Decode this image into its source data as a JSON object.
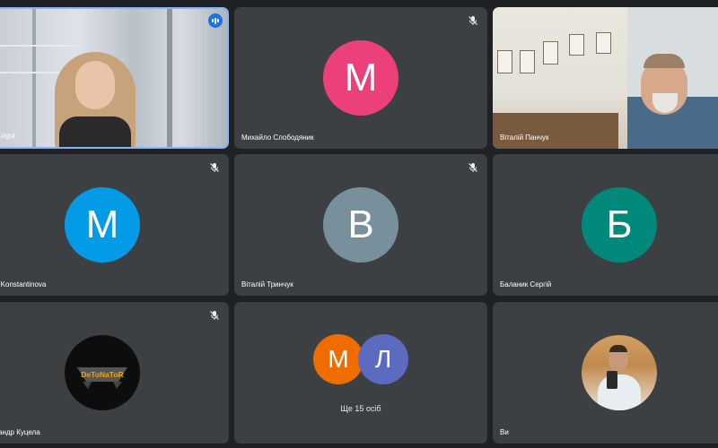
{
  "tiles": [
    {
      "name": "Kogut"
    },
    {
      "name": "Михайло Слободяник",
      "initial": "М",
      "color": "#ec407a"
    },
    {
      "name": "Віталій Панчук"
    },
    {
      "name": "a Konstantinova",
      "initial": "М",
      "color": "#039be5"
    },
    {
      "name": "Віталій Тринчук",
      "initial": "В",
      "color": "#78909c"
    },
    {
      "name": "Баланик Сергій",
      "initial": "Б",
      "color": "#00897b"
    },
    {
      "name": "сандр Куцела",
      "logo_text": "DeToNaToR"
    },
    {
      "name": "Ще 15 осіб",
      "initials": [
        {
          "letter": "М",
          "color": "#ef6c00"
        },
        {
          "letter": "Л",
          "color": "#5c6bc0"
        }
      ]
    },
    {
      "name": "Ви"
    }
  ]
}
